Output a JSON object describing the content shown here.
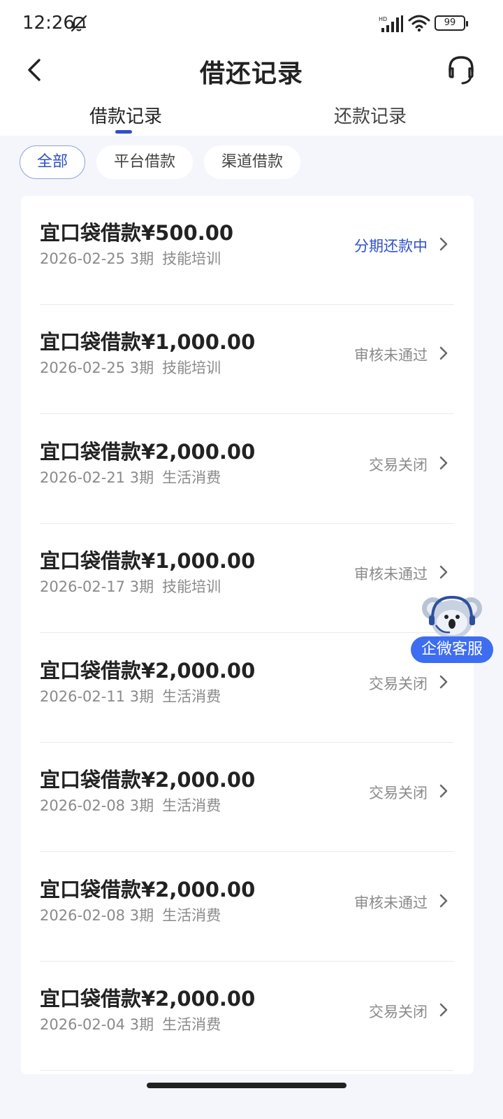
{
  "status_bar": {
    "time": "12:26",
    "battery": "99",
    "hd_label": "HD"
  },
  "header": {
    "title": "借还记录"
  },
  "tabs": [
    {
      "label": "借款记录",
      "active": true
    },
    {
      "label": "还款记录",
      "active": false
    }
  ],
  "filters": [
    {
      "label": "全部",
      "active": true
    },
    {
      "label": "平台借款",
      "active": false
    },
    {
      "label": "渠道借款",
      "active": false
    }
  ],
  "records": [
    {
      "title": "宜口袋借款¥500.00",
      "date": "2026-02-25",
      "term": "3期",
      "purpose": "技能培训",
      "status": "分期还款中",
      "status_color": "#2f4fc9"
    },
    {
      "title": "宜口袋借款¥1,000.00",
      "date": "2026-02-25",
      "term": "3期",
      "purpose": "技能培训",
      "status": "审核未通过",
      "status_color": "#8a8a8a"
    },
    {
      "title": "宜口袋借款¥2,000.00",
      "date": "2026-02-21",
      "term": "3期",
      "purpose": "生活消费",
      "status": "交易关闭",
      "status_color": "#8a8a8a"
    },
    {
      "title": "宜口袋借款¥1,000.00",
      "date": "2026-02-17",
      "term": "3期",
      "purpose": "技能培训",
      "status": "审核未通过",
      "status_color": "#8a8a8a"
    },
    {
      "title": "宜口袋借款¥2,000.00",
      "date": "2026-02-11",
      "term": "3期",
      "purpose": "生活消费",
      "status": "交易关闭",
      "status_color": "#8a8a8a"
    },
    {
      "title": "宜口袋借款¥2,000.00",
      "date": "2026-02-08",
      "term": "3期",
      "purpose": "生活消费",
      "status": "交易关闭",
      "status_color": "#8a8a8a"
    },
    {
      "title": "宜口袋借款¥2,000.00",
      "date": "2026-02-08",
      "term": "3期",
      "purpose": "生活消费",
      "status": "审核未通过",
      "status_color": "#8a8a8a"
    },
    {
      "title": "宜口袋借款¥2,000.00",
      "date": "2026-02-04",
      "term": "3期",
      "purpose": "生活消费",
      "status": "交易关闭",
      "status_color": "#8a8a8a"
    }
  ],
  "float_service": {
    "label": "企微客服"
  },
  "colors": {
    "accent": "#2f4fc9",
    "float_button": "#3d6df0",
    "background": "#f4f6fb"
  },
  "icons": {
    "back": "chevron-left-icon",
    "service": "headset-icon",
    "row_arrow": "chevron-right-icon",
    "mascot": "koala-icon"
  }
}
